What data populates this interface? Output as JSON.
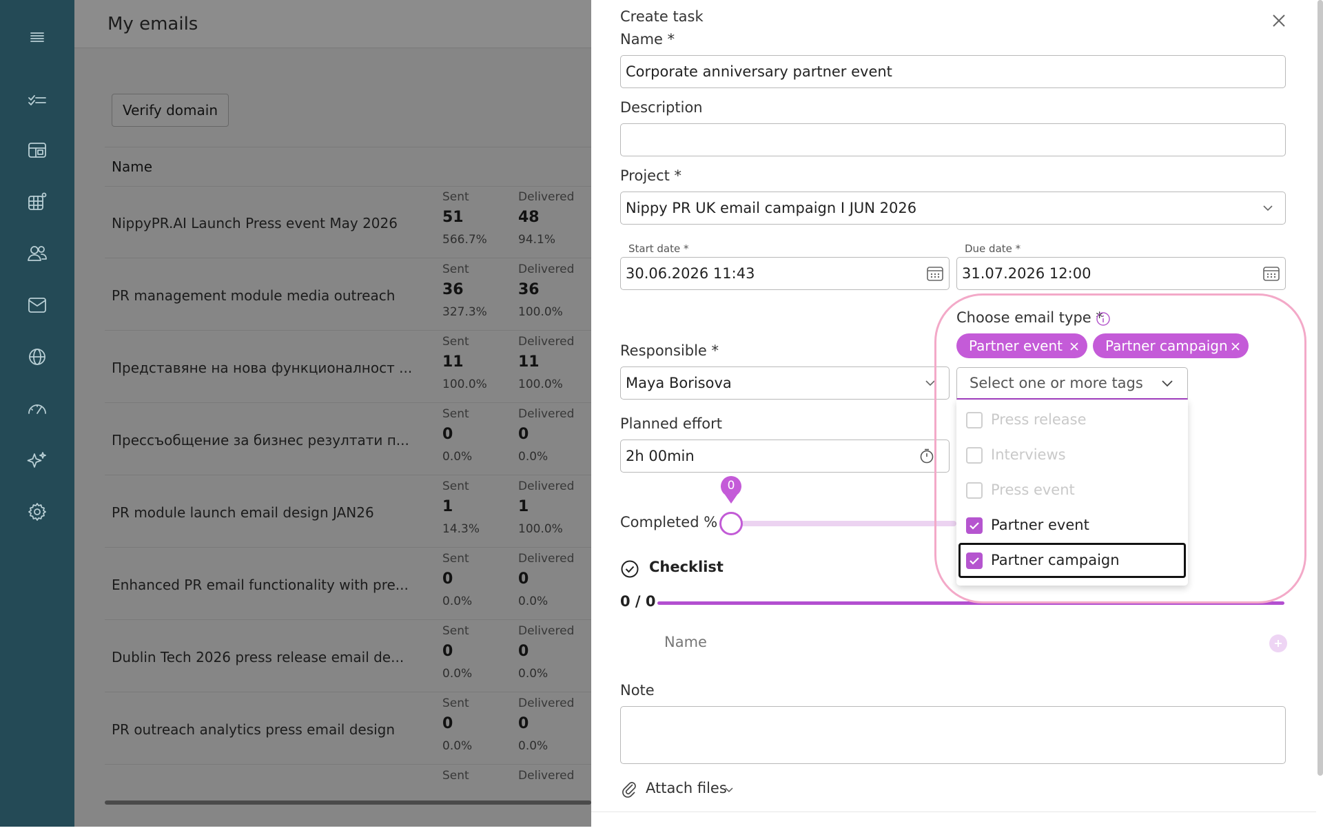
{
  "sidebar": {
    "icons": [
      "menu-icon",
      "tasks-icon",
      "dashboard-icon",
      "projects-icon",
      "contacts-icon",
      "email-icon",
      "media-icon",
      "analytics-icon",
      "ai-sparkle-icon",
      "settings-icon"
    ]
  },
  "background_page": {
    "title": "My emails",
    "verify_domain_label": "Verify domain",
    "name_header": "Name",
    "stat_labels": {
      "sent": "Sent",
      "delivered": "Delivered"
    },
    "rows": [
      {
        "name": "NippyPR.AI Launch Press event May 2026",
        "sent": "51",
        "sent_pct": "566.7%",
        "delivered": "48",
        "delivered_pct": "94.1%"
      },
      {
        "name": "PR management module media outreach",
        "sent": "36",
        "sent_pct": "327.3%",
        "delivered": "36",
        "delivered_pct": "100.0%"
      },
      {
        "name": "Представяне на нова функционалност ...",
        "sent": "11",
        "sent_pct": "100.0%",
        "delivered": "11",
        "delivered_pct": "100.0%"
      },
      {
        "name": "Прессъобщение за бизнес резултати п...",
        "sent": "0",
        "sent_pct": "0.0%",
        "delivered": "0",
        "delivered_pct": "0.0%"
      },
      {
        "name": "PR module launch email design JAN26",
        "sent": "1",
        "sent_pct": "14.3%",
        "delivered": "1",
        "delivered_pct": "100.0%"
      },
      {
        "name": "Enhanced PR email functionality with pre...",
        "sent": "0",
        "sent_pct": "0.0%",
        "delivered": "0",
        "delivered_pct": "0.0%"
      },
      {
        "name": "Dublin Tech 2026 press release email de...",
        "sent": "0",
        "sent_pct": "0.0%",
        "delivered": "0",
        "delivered_pct": "0.0%"
      },
      {
        "name": "PR outreach analytics press email design",
        "sent": "0",
        "sent_pct": "0.0%",
        "delivered": "0",
        "delivered_pct": "0.0%"
      }
    ]
  },
  "task": {
    "header": "Create task",
    "name_label": "Name *",
    "name_value": "Corporate anniversary partner event",
    "description_label": "Description",
    "description_value": "",
    "project_label": "Project *",
    "project_value": "Nippy PR UK email campaign I JUN 2026",
    "start_label": "Start date *",
    "start_value": "30.06.2026 11:43",
    "due_label": "Due date *",
    "due_value": "31.07.2026 12:00",
    "responsible_label": "Responsible *",
    "responsible_value": "Maya Borisova",
    "effort_label": "Planned effort",
    "effort_value": "2h 00min",
    "completed_label": "Completed % :",
    "completed_value": "0",
    "completed_fraction": 0,
    "checklist_label": "Checklist",
    "checklist_count": "0 / 0",
    "checklist_name_placeholder": "Name",
    "note_label": "Note",
    "attach_label": "Attach files",
    "email_type": {
      "label": "Choose email type *",
      "selected": [
        "Partner event",
        "Partner campaign"
      ],
      "placeholder": "Select one or more tags",
      "options": [
        {
          "label": "Press release",
          "checked": false,
          "disabled": true
        },
        {
          "label": "Interviews",
          "checked": false,
          "disabled": true
        },
        {
          "label": "Press event",
          "checked": false,
          "disabled": true
        },
        {
          "label": "Partner event",
          "checked": true,
          "disabled": false
        },
        {
          "label": "Partner campaign",
          "checked": true,
          "disabled": false
        }
      ]
    }
  },
  "colors": {
    "sidebar": "#244a56",
    "accent": "#c45bd8",
    "highlight": "#f3a9c8"
  }
}
